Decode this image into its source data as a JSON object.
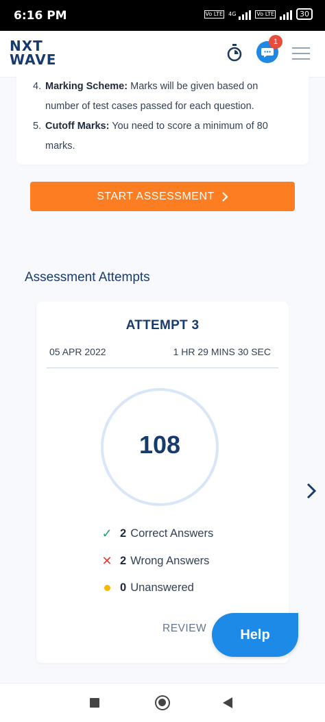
{
  "status_bar": {
    "time": "6:16 PM",
    "network": "4G",
    "volte_1": "Vo LTE",
    "volte_2": "Vo LTE",
    "battery": "30"
  },
  "header": {
    "logo_line1": "NXT",
    "logo_line2": "WAVE",
    "notification_count": "1",
    "icons": [
      "timer-icon",
      "chat-icon",
      "menu-icon"
    ]
  },
  "instructions": [
    {
      "num": "4.",
      "title": "Marking Scheme:",
      "text": "Marks will be given based on number of test cases passed for each question."
    },
    {
      "num": "5.",
      "title": "Cutoff Marks:",
      "text": "You need to score a minimum of 80 marks."
    }
  ],
  "start_button": {
    "label": "START ASSESSMENT",
    "icon": "chevron-right-icon"
  },
  "attempts": {
    "section_title": "Assessment Attempts",
    "card": {
      "title": "ATTEMPT 3",
      "date": "05 APR 2022",
      "duration": "1 HR 29 MINS 30 SEC",
      "score": "108",
      "stats": [
        {
          "icon": "check-icon",
          "count": "2",
          "label": "Correct Answers"
        },
        {
          "icon": "cross-icon",
          "count": "2",
          "label": "Wrong Answers"
        },
        {
          "icon": "dot-icon",
          "count": "0",
          "label": "Unanswered"
        }
      ],
      "review_label": "REVIEW"
    }
  },
  "help_button": {
    "label": "Help"
  },
  "colors": {
    "primary_navy": "#183b6e",
    "accent_orange": "#fd7e22",
    "help_blue": "#1c8ae6",
    "correct_green": "#22a06b",
    "wrong_red": "#e53935",
    "unanswered_yellow": "#f5b700"
  }
}
